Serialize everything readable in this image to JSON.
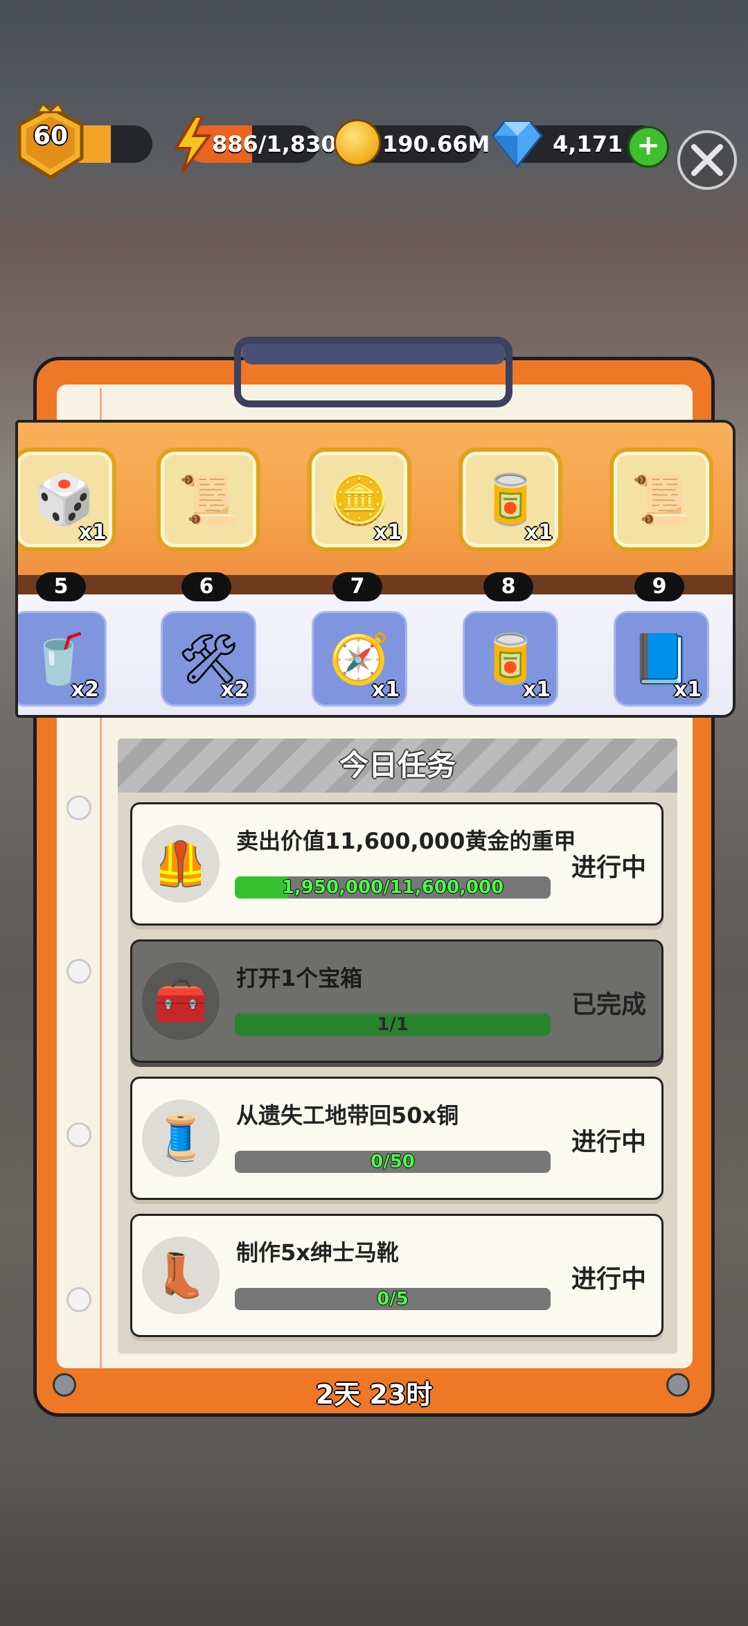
{
  "hud": {
    "level": "60",
    "energy": "886/1,830",
    "gold": "190.66M",
    "gems": "4,171",
    "add_label": "+"
  },
  "rewards": {
    "top": [
      {
        "icon": "dice-icon",
        "glyph": "🎲",
        "qty": "x1"
      },
      {
        "icon": "scroll-badge-icon",
        "glyph": "📜",
        "qty": ""
      },
      {
        "icon": "gold-coin-boost-icon",
        "glyph": "🪙",
        "qty": "x1"
      },
      {
        "icon": "canned-food-icon",
        "glyph": "🥫",
        "qty": "x1"
      },
      {
        "icon": "scroll-meal-icon",
        "glyph": "📜",
        "qty": ""
      }
    ],
    "levels": [
      "5",
      "6",
      "7",
      "8",
      "9"
    ],
    "bottom": [
      {
        "icon": "soda-can-icon",
        "glyph": "🥤",
        "qty": "x2"
      },
      {
        "icon": "blueprint-book-icon",
        "glyph": "🛠",
        "qty": "x2"
      },
      {
        "icon": "compass-icon",
        "glyph": "🧭",
        "qty": "x1"
      },
      {
        "icon": "fish-can-icon",
        "glyph": "🥫",
        "qty": "x1"
      },
      {
        "icon": "xp-book-icon",
        "glyph": "📘",
        "qty": "x1"
      }
    ]
  },
  "tasks": {
    "title": "今日任务",
    "items": [
      {
        "name": "卖出价值11,600,000黄金的重甲",
        "progress": "1,950,000/11,600,000",
        "fraction": 0.168,
        "status": "进行中",
        "icon": "armor-icon",
        "glyph": "🦺",
        "done": false
      },
      {
        "name": "打开1个宝箱",
        "progress": "1/1",
        "fraction": 1.0,
        "status": "已完成",
        "icon": "treasure-chest-icon",
        "glyph": "🧰",
        "done": true
      },
      {
        "name": "从遗失工地带回50x铜",
        "progress": "0/50",
        "fraction": 0.0,
        "status": "进行中",
        "icon": "copper-spool-icon",
        "glyph": "🧵",
        "done": false
      },
      {
        "name": "制作5x绅士马靴",
        "progress": "0/5",
        "fraction": 0.0,
        "status": "进行中",
        "icon": "boots-icon",
        "glyph": "👢",
        "done": false
      }
    ]
  },
  "footer": {
    "timer": "2天 23时"
  },
  "colors": {
    "board": "#ee7826",
    "progress_fill": "#35c12f",
    "reward_strip": "#f5a04a"
  }
}
